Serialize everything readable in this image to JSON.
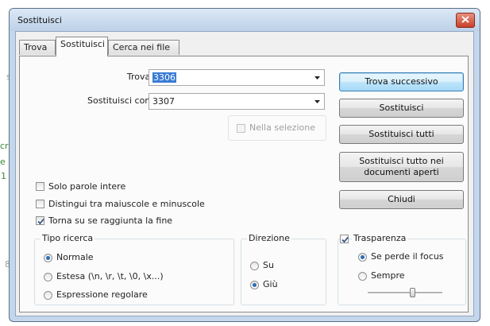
{
  "window": {
    "title": "Sostituisci",
    "close_icon": "close-icon"
  },
  "tabs": [
    {
      "label": "Trova",
      "active": false
    },
    {
      "label": "Sostituisci",
      "active": true
    },
    {
      "label": "Cerca nei file",
      "active": false
    }
  ],
  "fields": {
    "find_label": "Trova:",
    "find_value": "3306",
    "replace_label": "Sostituisci con:",
    "replace_value": "3307"
  },
  "in_selection": {
    "label": "Nella selezione",
    "checked": false,
    "enabled": false
  },
  "buttons": {
    "find_next": "Trova successivo",
    "replace": "Sostituisci",
    "replace_all": "Sostituisci tutti",
    "replace_all_open_line1": "Sostituisci tutto nei",
    "replace_all_open_line2": "documenti aperti",
    "close": "Chiudi"
  },
  "options": [
    {
      "label": "Solo parole intere",
      "checked": false
    },
    {
      "label": "Distingui tra maiuscole e minuscole",
      "checked": false
    },
    {
      "label": "Torna su se raggiunta la fine",
      "checked": true
    }
  ],
  "search_mode": {
    "title": "Tipo ricerca",
    "items": [
      {
        "label": "Normale",
        "selected": true
      },
      {
        "label": "Estesa (\\n, \\r, \\t, \\0, \\x...)",
        "selected": false
      },
      {
        "label": "Espressione regolare",
        "selected": false
      }
    ]
  },
  "direction": {
    "title": "Direzione",
    "items": [
      {
        "label": "Su",
        "selected": false
      },
      {
        "label": "Giù",
        "selected": true
      }
    ]
  },
  "transparency": {
    "label": "Trasparenza",
    "checked": true,
    "items": [
      {
        "label": "Se perde il focus",
        "selected": true
      },
      {
        "label": "Sempre",
        "selected": false
      }
    ],
    "slider_level": 0.6
  },
  "background": {
    "glyphs": [
      "s",
      "cr",
      "e",
      "1",
      "8"
    ]
  },
  "colors": {
    "accent": "#3a7bd5",
    "window_frame": "#c4d6ea",
    "close_button": "#c8412c"
  }
}
